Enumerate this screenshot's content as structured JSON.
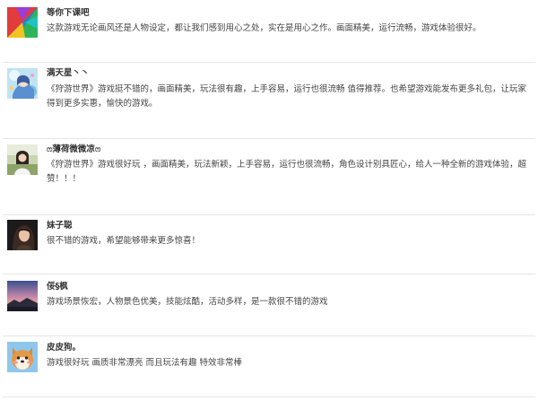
{
  "comments": [
    {
      "username": "等你下课吧",
      "text": "这款游戏无论画风还是人物设定，都让我们感到用心之处，实在是用心之作。画面精美，运行流畅，游戏体验很好。",
      "avatar": "colorful-gradient-avatar"
    },
    {
      "username": "满天星丶丶",
      "text": "《狩游世界》游戏挺不错的，画面精美，玩法很有趣，上手容易，运行也很流畅 值得推荐。也希望游戏能发布更多礼包，让玩家得到更多实惠，愉快的游戏。",
      "avatar": "anime-girl-avatar"
    },
    {
      "username": "ෆ薄荷微微凉ෆ",
      "text": "《狩游世界》游戏很好玩 ，画面精美，玩法新颖，上手容易，运行也很流畅，角色设计别具匠心，给人一种全新的游戏体验，超赞！！！",
      "avatar": "girl-outdoor-avatar"
    },
    {
      "username": "妹子聪",
      "text": "很不错的游戏，希望能够带来更多惊喜！",
      "avatar": "girl-portrait-avatar"
    },
    {
      "username": "俀§枫",
      "text": "游戏场景恢宏，人物景色优美，技能炫酷，活动多样，是一款很不错的游戏",
      "avatar": "sunset-landscape-avatar"
    },
    {
      "username": "皮皮狗。",
      "text": "游戏很好玩 画质非常漂亮 而且玩法有趣 特效非常棒",
      "avatar": "shiba-dog-avatar"
    }
  ],
  "colors": {
    "divider": "#e6e6e6",
    "username": "#333333",
    "text": "#444444"
  }
}
